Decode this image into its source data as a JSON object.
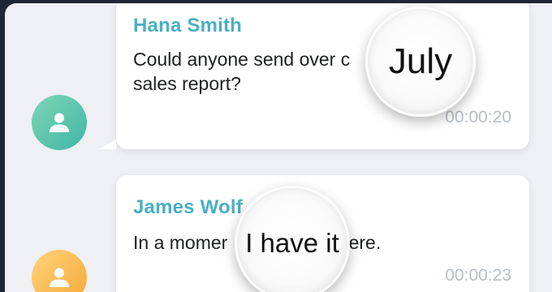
{
  "messages": [
    {
      "sender": "Hana Smith",
      "text_line1": "Could anyone send over c",
      "text_line2": "sales report?",
      "time": "00:00:20",
      "avatar_color": "#3fb6a6",
      "avatar_icon": "user-icon",
      "magnifier_text": "July"
    },
    {
      "sender": "James Wolf",
      "text_line1": "In a momer",
      "text_line1_tail": "ight here.",
      "time": "00:00:23",
      "avatar_color": "#f4a93a",
      "avatar_icon": "user-icon",
      "magnifier_text": "I have it"
    }
  ],
  "colors": {
    "sender_name": "#4aafc4",
    "timestamp": "#b9bec4",
    "background": "#eef0f3"
  }
}
